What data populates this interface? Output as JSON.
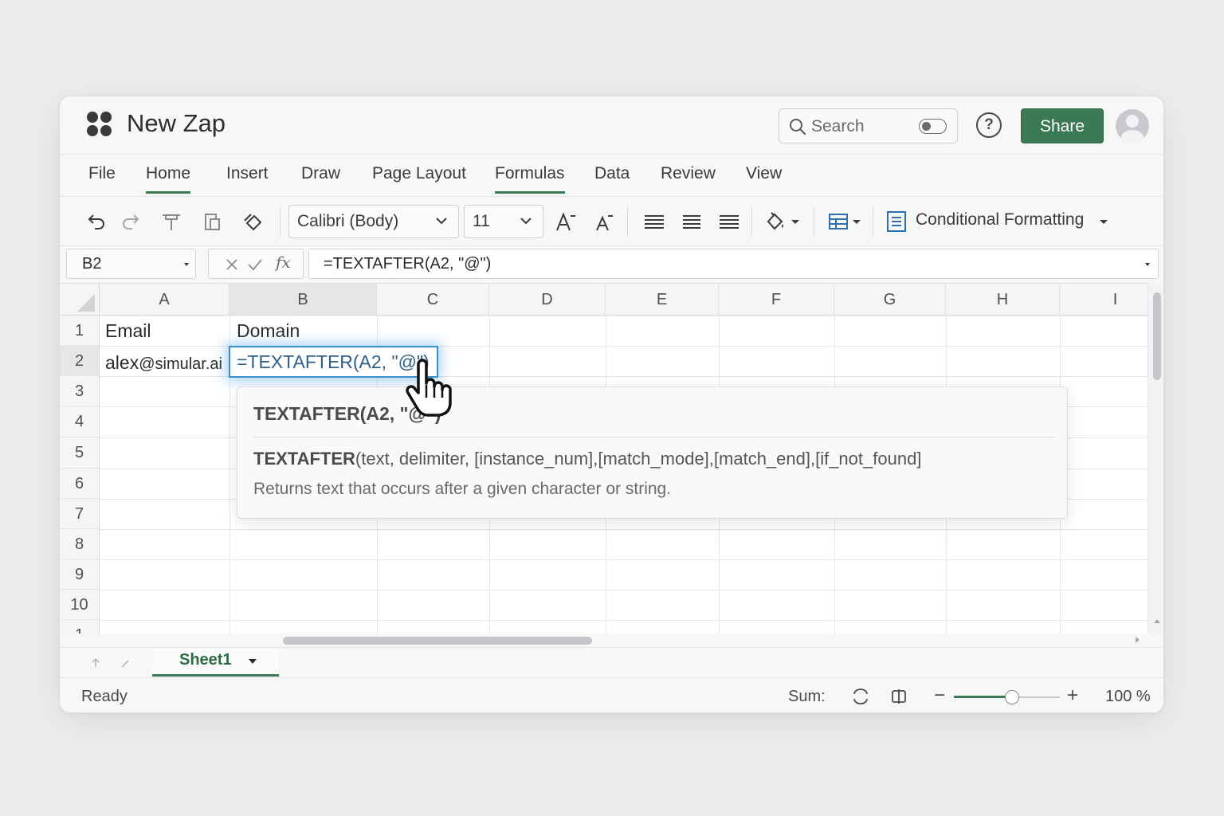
{
  "app": {
    "title": "New Zap"
  },
  "header": {
    "search_placeholder": "Search",
    "help_symbol": "?",
    "share_label": "Share",
    "accent_color": "#3b7a55"
  },
  "ribbon": {
    "tabs": [
      {
        "label": "File"
      },
      {
        "label": "Home"
      },
      {
        "label": "Insert"
      },
      {
        "label": "Draw"
      },
      {
        "label": "Page Layout"
      },
      {
        "label": "Formulas"
      },
      {
        "label": "Data"
      },
      {
        "label": "Review"
      },
      {
        "label": "View"
      }
    ],
    "active_tab": "Home",
    "underlined_tabs": [
      "Home",
      "Formulas"
    ]
  },
  "toolbar": {
    "font_name": "Calibri (Body)",
    "font_size": "11",
    "conditional_formatting_label": "Conditional Formatting",
    "icons": [
      "undo-icon",
      "redo-icon",
      "format-painter-icon",
      "clipboard-icon",
      "clear-format-icon",
      "increase-font-icon",
      "decrease-font-icon",
      "align-left-icon",
      "align-center-icon",
      "align-right-icon",
      "fill-color-icon",
      "table-format-icon",
      "conditional-formatting-icon"
    ]
  },
  "formula_bar": {
    "name_box": "B2",
    "formula": "=TEXTAFTER(A2, \"@\")"
  },
  "grid": {
    "columns": [
      "A",
      "B",
      "C",
      "D",
      "E",
      "F",
      "G",
      "H",
      "I"
    ],
    "rows": [
      "1",
      "2",
      "3",
      "4",
      "5",
      "6",
      "7",
      "8",
      "9",
      "10",
      "1"
    ],
    "cells": {
      "A1": "Email",
      "B1": "Domain",
      "A2_user": "alex",
      "A2_domain": "@simular.ai",
      "B2": "=TEXTAFTER(A2, \"@\")"
    },
    "selected_cell": "B2"
  },
  "tooltip": {
    "title": "TEXTAFTER(A2, \"@\")",
    "function_name": "TEXTAFTER",
    "signature_args": "(text, delimiter, [instance_num],[match_mode],[match_end],[if_not_found]",
    "description": "Returns text that occurs after a given character or string."
  },
  "sheets": [
    {
      "name": "Sheet1",
      "active": true
    }
  ],
  "status": {
    "ready": "Ready",
    "sum_label": "Sum:",
    "zoom_label": "100 %",
    "zoom_minus": "−",
    "zoom_plus": "+",
    "zoom_slider_fraction": 0.55
  }
}
